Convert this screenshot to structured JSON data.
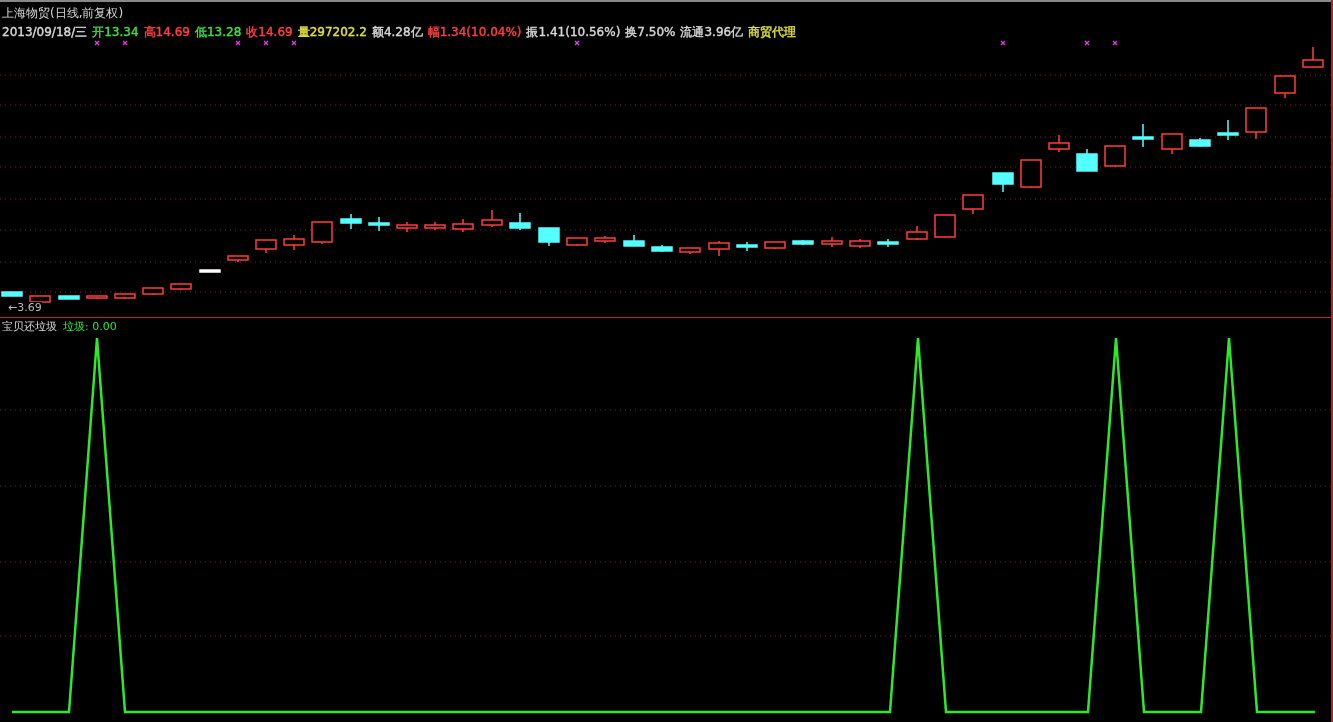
{
  "main_panel": {
    "title": "上海物贸(日线,前复权)",
    "quote": [
      {
        "text": "2013/09/18/三",
        "color": "#d8d8d8"
      },
      {
        "text": "开13.34",
        "color": "#40e040"
      },
      {
        "text": "高14.69",
        "color": "#ff4040"
      },
      {
        "text": "低13.28",
        "color": "#40e040"
      },
      {
        "text": "收14.69",
        "color": "#ff4040"
      },
      {
        "text": "量297202.2",
        "color": "#e0e040"
      },
      {
        "text": "额4.28亿",
        "color": "#d8d8d8"
      },
      {
        "text": "幅1.34(10.04%)",
        "color": "#ff4040"
      },
      {
        "text": "振1.41(10.56%)",
        "color": "#d8d8d8"
      },
      {
        "text": "换7.50%",
        "color": "#d8d8d8"
      },
      {
        "text": "流通3.96亿",
        "color": "#d8d8d8"
      },
      {
        "text": "商贸代理",
        "color": "#e0e040"
      }
    ],
    "low_marker": "←3.69"
  },
  "indicator_panel": {
    "name": "宝贝还垃圾",
    "value_label": "垃圾: 0.00"
  }
}
